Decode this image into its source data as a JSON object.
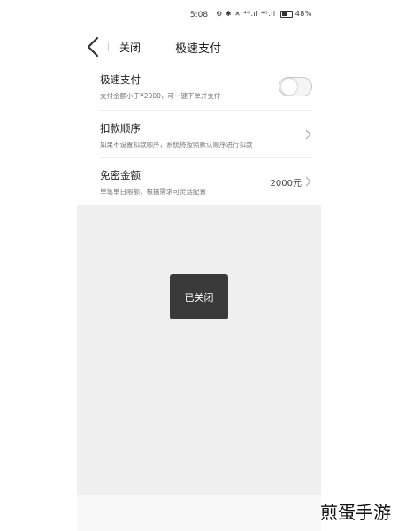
{
  "status_bar": {
    "time": "5:08",
    "icons_text": "⚙ ✱ ✕ ⁴ᴳ.ıl ⁴ᴳ.ıl",
    "battery": "48%"
  },
  "header": {
    "back_icon": "chevron-left-icon",
    "close_label": "关闭",
    "title": "极速支付"
  },
  "settings": {
    "fast_pay": {
      "label": "极速支付",
      "description": "支付金额小于¥2000，可一键下单并支付",
      "toggle_on": false
    },
    "deduction_order": {
      "label": "扣款顺序",
      "description": "如果不设置扣款顺序，系统将按照默认顺序进行扣款"
    },
    "free_amount": {
      "label": "免密金额",
      "description": "单笔单日限额，根据需求可灵活配置",
      "value": "2000元"
    }
  },
  "toast": {
    "text": "已关闭"
  },
  "watermark": "煎蛋手游"
}
